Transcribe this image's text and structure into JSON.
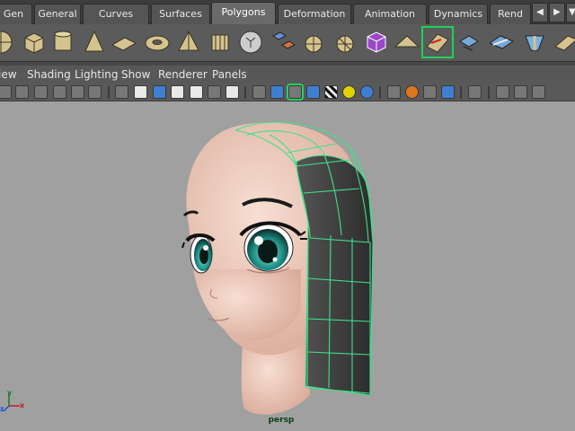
{
  "shelf": {
    "tabs": [
      {
        "label": "Gen",
        "active": false
      },
      {
        "label": "General",
        "active": false
      },
      {
        "label": "Curves",
        "active": false
      },
      {
        "label": "Surfaces",
        "active": false
      },
      {
        "label": "Polygons",
        "active": true
      },
      {
        "label": "Deformation",
        "active": false
      },
      {
        "label": "Animation",
        "active": false
      },
      {
        "label": "Dynamics",
        "active": false
      },
      {
        "label": "Rend",
        "active": false
      }
    ],
    "scroll_left": "◀",
    "scroll_right": "▶",
    "menu_glyph": "▼"
  },
  "panel_menu": [
    "iew",
    "Shading",
    "Lighting",
    "Show",
    "Renderer",
    "Panels"
  ],
  "viewport": {
    "camera": "persp",
    "axes": {
      "x": "x",
      "y": "y",
      "z": "z"
    },
    "colors": {
      "background": "#a0a0a0",
      "skin": "#f2cbbd",
      "hair": "#3c3c3c",
      "wireframe": "#3fe08a",
      "iris": "#1f8f86"
    }
  }
}
